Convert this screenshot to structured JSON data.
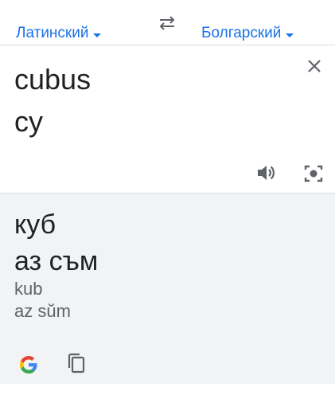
{
  "language_bar": {
    "source_language": "Латинский",
    "target_language": "Болгарский",
    "swap_icon": "swap-arrows-icon"
  },
  "source": {
    "lines": [
      "cubus",
      "cy"
    ],
    "clear_icon": "close-icon",
    "speaker_icon": "speaker-icon",
    "camera_icon": "camera-lens-icon"
  },
  "result": {
    "lines": [
      "куб",
      "аз съм"
    ],
    "transliteration": [
      "kub",
      "az sŭm"
    ],
    "logo_icon": "google-g-icon",
    "copy_icon": "copy-icon"
  },
  "colors": {
    "accent": "#1a73e8",
    "text": "#202124",
    "secondary_text": "#5f6368",
    "result_background": "#f1f3f4",
    "divider": "#dadce0"
  }
}
